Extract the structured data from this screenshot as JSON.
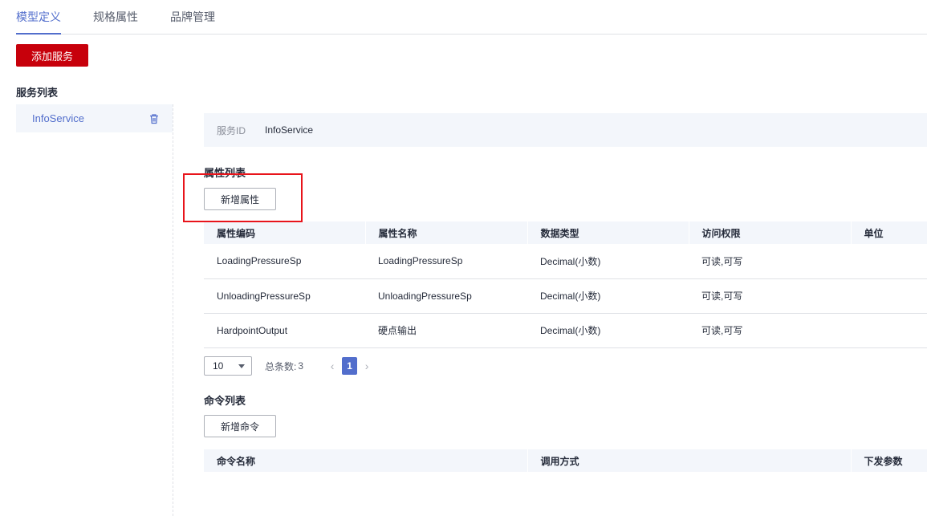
{
  "tabs": [
    {
      "label": "模型定义",
      "active": true
    },
    {
      "label": "规格属性",
      "active": false
    },
    {
      "label": "品牌管理",
      "active": false
    }
  ],
  "add_service_label": "添加服务",
  "service_list": {
    "title": "服务列表",
    "items": [
      {
        "name": "InfoService",
        "icon": "trash-icon"
      }
    ]
  },
  "service_detail": {
    "id_label": "服务ID",
    "id_value": "InfoService"
  },
  "properties": {
    "title": "属性列表",
    "add_label": "新增属性",
    "columns": [
      "属性编码",
      "属性名称",
      "数据类型",
      "访问权限",
      "单位"
    ],
    "rows": [
      [
        "LoadingPressureSp",
        "LoadingPressureSp",
        "Decimal(小数)",
        "可读,可写",
        ""
      ],
      [
        "UnloadingPressureSp",
        "UnloadingPressureSp",
        "Decimal(小数)",
        "可读,可写",
        ""
      ],
      [
        "HardpointOutput",
        "硬点输出",
        "Decimal(小数)",
        "可读,可写",
        ""
      ]
    ],
    "pagination": {
      "page_size": "10",
      "total_label": "总条数:",
      "total": "3",
      "current_page": "1",
      "prev": "‹",
      "next": "›"
    }
  },
  "commands": {
    "title": "命令列表",
    "add_label": "新增命令",
    "columns": [
      "命令名称",
      "调用方式",
      "下发参数"
    ]
  },
  "colors": {
    "accent": "#526ecc",
    "primary_button": "#c7000b",
    "highlight_frame": "#e8141b",
    "panel_bg": "#f3f6fb"
  }
}
